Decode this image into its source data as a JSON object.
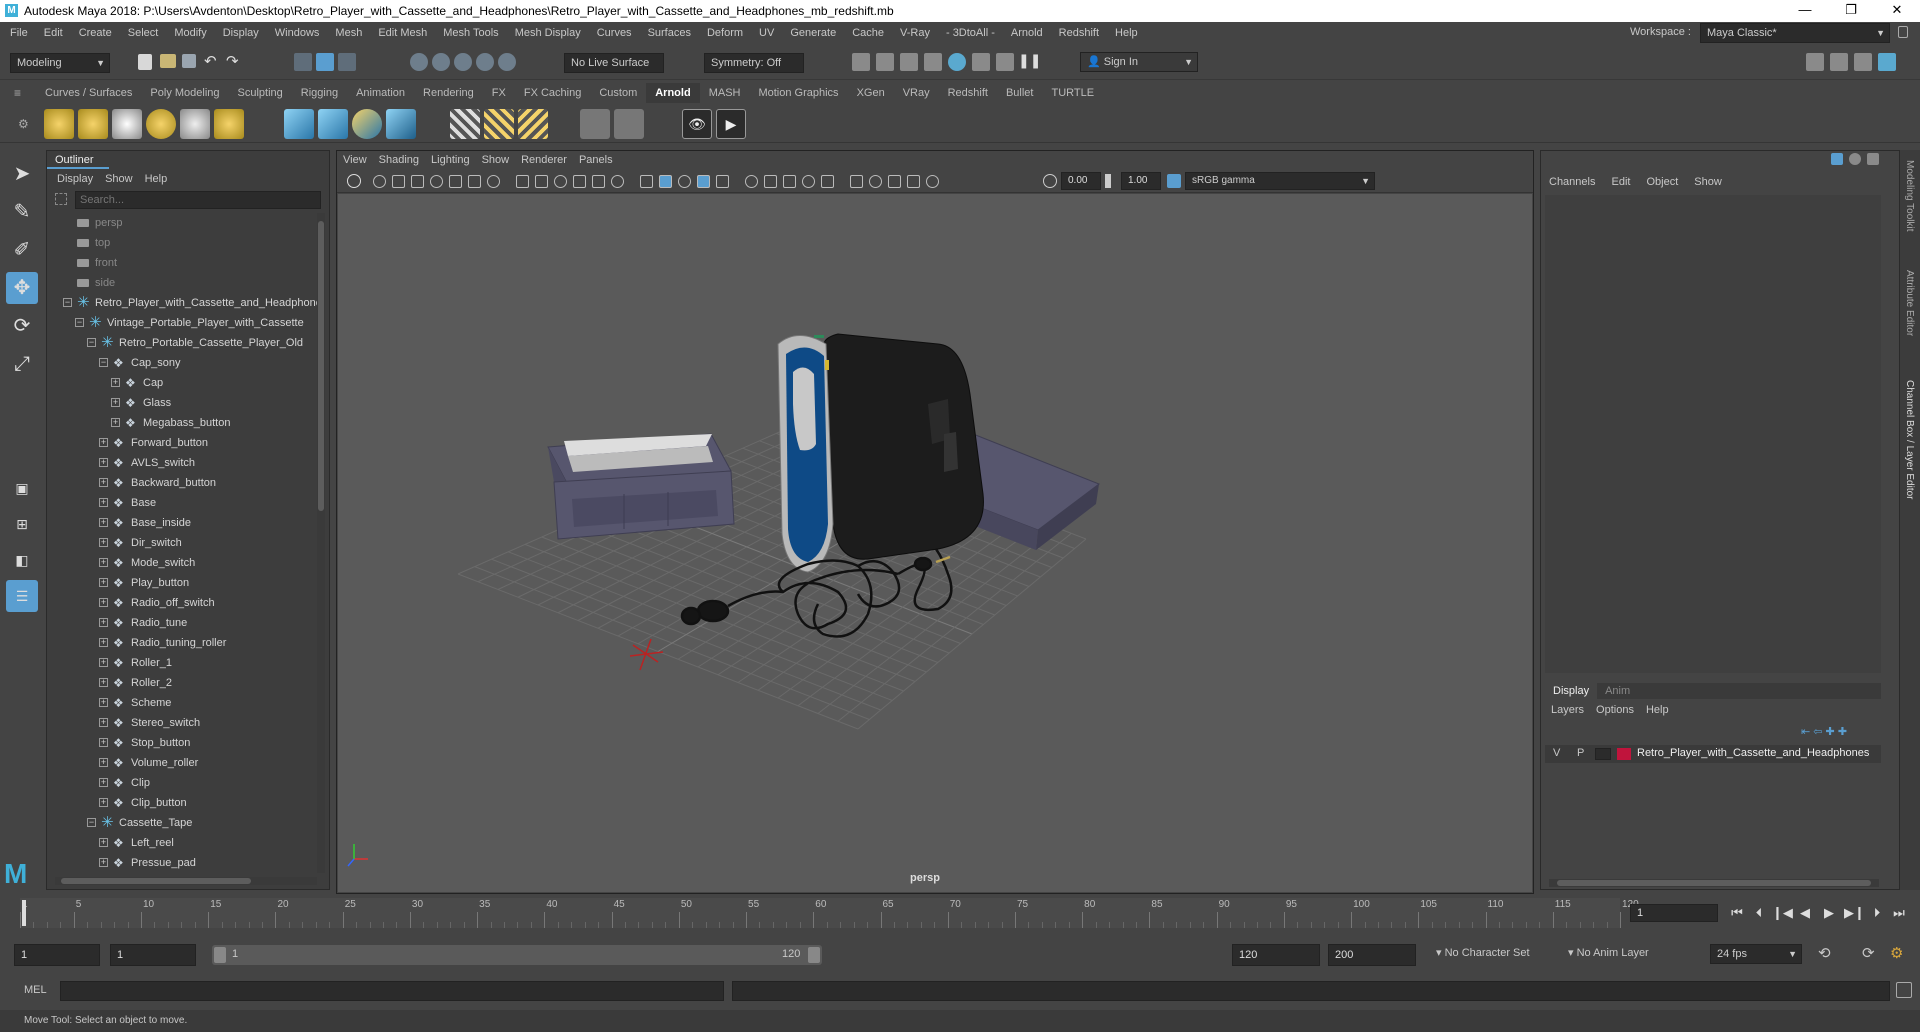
{
  "window": {
    "title": "Autodesk Maya 2018: P:\\Users\\Avdenton\\Desktop\\Retro_Player_with_Cassette_and_Headphones\\Retro_Player_with_Cassette_and_Headphones_mb_redshift.mb",
    "minimize": "—",
    "maximize": "❐",
    "close": "✕",
    "brand_color": "#3fb0d8"
  },
  "menus": [
    "File",
    "Edit",
    "Create",
    "Select",
    "Modify",
    "Display",
    "Windows",
    "Mesh",
    "Edit Mesh",
    "Mesh Tools",
    "Mesh Display",
    "Curves",
    "Surfaces",
    "Deform",
    "UV",
    "Generate",
    "Cache",
    "V-Ray",
    "- 3DtoAll -",
    "Arnold",
    "Redshift",
    "Help"
  ],
  "workspace": {
    "label": "Workspace :",
    "value": "Maya Classic*"
  },
  "status_line": {
    "mode": "Modeling",
    "live_surface": "No Live Surface",
    "symmetry": "Symmetry: Off",
    "sign_in": "Sign In"
  },
  "shelf_tabs": [
    "Curves / Surfaces",
    "Poly Modeling",
    "Sculpting",
    "Rigging",
    "Animation",
    "Rendering",
    "FX",
    "FX Caching",
    "Custom",
    "Arnold",
    "MASH",
    "Motion Graphics",
    "XGen",
    "VRay",
    "Redshift",
    "Bullet",
    "TURTLE"
  ],
  "active_shelf_tab": "Arnold",
  "outliner": {
    "title": "Outliner",
    "menus": [
      "Display",
      "Show",
      "Help"
    ],
    "search_placeholder": "Search...",
    "rows": [
      {
        "label": "persp",
        "type": "camera",
        "depth": 0,
        "dim": true
      },
      {
        "label": "top",
        "type": "camera",
        "depth": 0,
        "dim": true
      },
      {
        "label": "front",
        "type": "camera",
        "depth": 0,
        "dim": true
      },
      {
        "label": "side",
        "type": "camera",
        "depth": 0,
        "dim": true
      },
      {
        "label": "Retro_Player_with_Cassette_and_Headphones",
        "type": "group",
        "depth": 0,
        "toggle": "−"
      },
      {
        "label": "Vintage_Portable_Player_with_Cassette",
        "type": "group",
        "depth": 1,
        "toggle": "−"
      },
      {
        "label": "Retro_Portable_Cassette_Player_Old",
        "type": "group",
        "depth": 2,
        "toggle": "−"
      },
      {
        "label": "Cap_sony",
        "type": "mesh",
        "depth": 3,
        "toggle": "−"
      },
      {
        "label": "Cap",
        "type": "mesh",
        "depth": 4,
        "toggle": "+"
      },
      {
        "label": "Glass",
        "type": "mesh",
        "depth": 4,
        "toggle": "+"
      },
      {
        "label": "Megabass_button",
        "type": "mesh",
        "depth": 4,
        "toggle": "+"
      },
      {
        "label": "Forward_button",
        "type": "mesh",
        "depth": 3,
        "toggle": "+"
      },
      {
        "label": "AVLS_switch",
        "type": "mesh",
        "depth": 3,
        "toggle": "+"
      },
      {
        "label": "Backward_button",
        "type": "mesh",
        "depth": 3,
        "toggle": "+"
      },
      {
        "label": "Base",
        "type": "mesh",
        "depth": 3,
        "toggle": "+"
      },
      {
        "label": "Base_inside",
        "type": "mesh",
        "depth": 3,
        "toggle": "+"
      },
      {
        "label": "Dir_switch",
        "type": "mesh",
        "depth": 3,
        "toggle": "+"
      },
      {
        "label": "Mode_switch",
        "type": "mesh",
        "depth": 3,
        "toggle": "+"
      },
      {
        "label": "Play_button",
        "type": "mesh",
        "depth": 3,
        "toggle": "+"
      },
      {
        "label": "Radio_off_switch",
        "type": "mesh",
        "depth": 3,
        "toggle": "+"
      },
      {
        "label": "Radio_tune",
        "type": "mesh",
        "depth": 3,
        "toggle": "+"
      },
      {
        "label": "Radio_tuning_roller",
        "type": "mesh",
        "depth": 3,
        "toggle": "+"
      },
      {
        "label": "Roller_1",
        "type": "mesh",
        "depth": 3,
        "toggle": "+"
      },
      {
        "label": "Roller_2",
        "type": "mesh",
        "depth": 3,
        "toggle": "+"
      },
      {
        "label": "Scheme",
        "type": "mesh",
        "depth": 3,
        "toggle": "+"
      },
      {
        "label": "Stereo_switch",
        "type": "mesh",
        "depth": 3,
        "toggle": "+"
      },
      {
        "label": "Stop_button",
        "type": "mesh",
        "depth": 3,
        "toggle": "+"
      },
      {
        "label": "Volume_roller",
        "type": "mesh",
        "depth": 3,
        "toggle": "+"
      },
      {
        "label": "Clip",
        "type": "mesh",
        "depth": 3,
        "toggle": "+"
      },
      {
        "label": "Clip_button",
        "type": "mesh",
        "depth": 3,
        "toggle": "+"
      },
      {
        "label": "Cassette_Tape",
        "type": "group",
        "depth": 2,
        "toggle": "−"
      },
      {
        "label": "Left_reel",
        "type": "mesh",
        "depth": 3,
        "toggle": "+"
      },
      {
        "label": "Pressue_pad",
        "type": "mesh",
        "depth": 3,
        "toggle": "+"
      }
    ]
  },
  "viewport": {
    "menus": [
      "View",
      "Shading",
      "Lighting",
      "Show",
      "Renderer",
      "Panels"
    ],
    "exposure": "0.00",
    "gamma": "1.00",
    "color_space": "sRGB gamma",
    "camera_label": "persp",
    "background": "#5a5a5a"
  },
  "channel_box": {
    "menus": [
      "Channels",
      "Edit",
      "Object",
      "Show"
    ]
  },
  "layer_editor": {
    "tabs": [
      "Display",
      "Anim"
    ],
    "menus": [
      "Layers",
      "Options",
      "Help"
    ],
    "layer": {
      "v": "V",
      "p": "P",
      "name": "Retro_Player_with_Cassette_and_Headphones",
      "color": "#c0143c"
    }
  },
  "side_tabs": [
    "Modeling Toolkit",
    "Attribute Editor",
    "Channel Box / Layer Editor"
  ],
  "timeline": {
    "ticks": [
      "1",
      "5",
      "10",
      "15",
      "20",
      "25",
      "30",
      "35",
      "40",
      "45",
      "50",
      "55",
      "60",
      "65",
      "70",
      "75",
      "80",
      "85",
      "90",
      "95",
      "100",
      "105",
      "110",
      "115",
      "120"
    ],
    "current_frame": "1"
  },
  "range": {
    "start": "1",
    "playback_start": "1",
    "slider_start": "1",
    "slider_end": "120",
    "playback_end": "120",
    "end": "200",
    "character_set": "No Character Set",
    "anim_layer": "No Anim Layer",
    "fps": "24 fps"
  },
  "command_line": {
    "label": "MEL"
  },
  "help_line": "Move Tool: Select an object to move."
}
